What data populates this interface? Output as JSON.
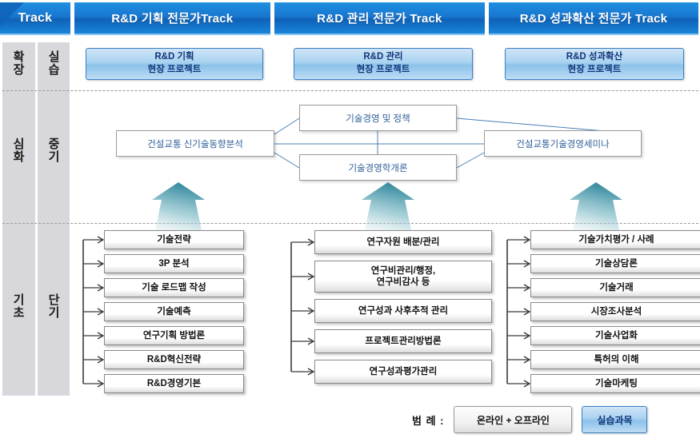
{
  "header": {
    "corner_label": "Track",
    "tracks": [
      {
        "label": "R&D 기획 전문가Track"
      },
      {
        "label": "R&D 관리 전문가 Track"
      },
      {
        "label": "R&D 성과확산 전문가 Track"
      }
    ]
  },
  "sidebar": {
    "rows": [
      {
        "level": "확장",
        "term": "실습"
      },
      {
        "level": "심화",
        "term": "중기"
      },
      {
        "level": "기초",
        "term": "단기"
      }
    ]
  },
  "projects": [
    {
      "line1": "R&D 기획",
      "line2": "현장 프로젝트"
    },
    {
      "line1": "R&D 관리",
      "line2": "현장 프로젝트"
    },
    {
      "line1": "R&D 성과확산",
      "line2": "현장 프로젝트"
    }
  ],
  "middle": {
    "left": "건설교통 신기술동향분석",
    "top": "기술경영 및 정책",
    "bottom": "기술경영학개론",
    "right": "건설교통기술경영세미나"
  },
  "columns": [
    {
      "courses": [
        "기술전략",
        "3P 분석",
        "기술 로드맵 작성",
        "기술예측",
        "연구기획 방법론",
        "R&D혁신전략",
        "R&D경영기본"
      ]
    },
    {
      "courses": [
        "연구자원 배분/관리",
        "연구비관리/행정,\n연구비감사 등",
        "연구성과 사후추적 관리",
        "프로젝트관리방법론",
        "연구성과평가관리"
      ]
    },
    {
      "courses": [
        "기술가치평가 / 사례",
        "기술상담론",
        "기술거래",
        "시장조사분석",
        "기술사업화",
        "특허의 이해",
        "기술마케팅"
      ]
    }
  ],
  "legend": {
    "label": "범 례 :",
    "online_offline": "온라인 + 오프라인",
    "practicum": "실습과목"
  },
  "colors": {
    "track_blue": "#1877cf",
    "project_blue": "#a9d2f0",
    "project_border": "#3b7fc4",
    "sidebar_gray": "#d8d8dc",
    "arrow_teal": "#4f9aa8",
    "link_blue": "#4a7fb5",
    "box_border": "#8a8a8a"
  }
}
